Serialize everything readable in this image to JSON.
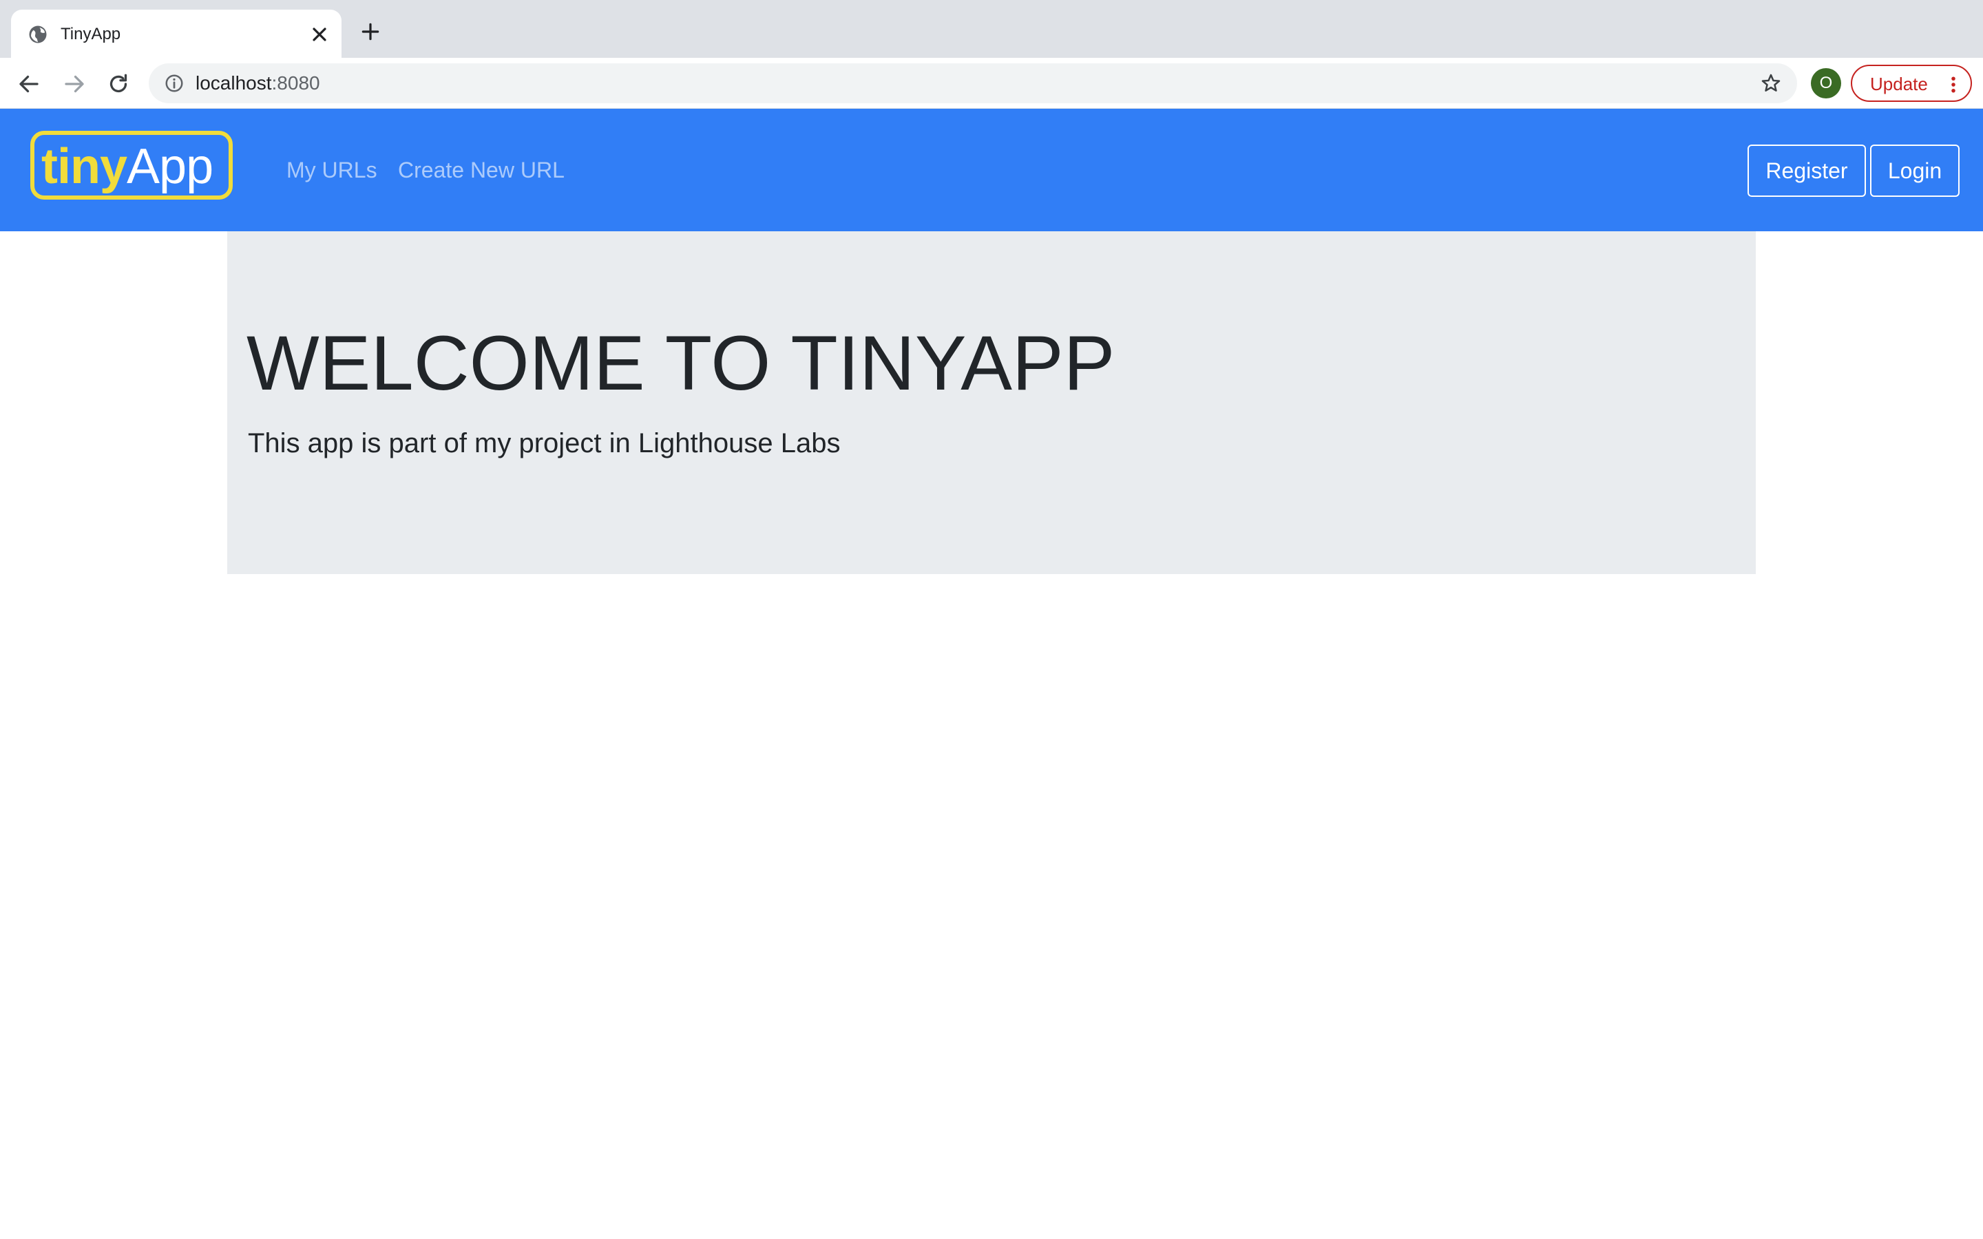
{
  "browser": {
    "tab_title": "TinyApp",
    "url_host": "localhost",
    "url_port": ":8080",
    "profile_initial": "O",
    "update_label": "Update"
  },
  "navbar": {
    "brand_tiny": "tiny",
    "brand_app": "App",
    "links": [
      "My URLs",
      "Create New URL"
    ],
    "register_label": "Register",
    "login_label": "Login"
  },
  "jumbotron": {
    "title": "WELCOME TO TINYAPP",
    "lead": "This app is part of my project in Lighthouse Labs"
  },
  "colors": {
    "navbar": "#317ef6",
    "brand_yellow": "#f1dc3b",
    "jumbotron_bg": "#e9ecef",
    "update_red": "#c5221f",
    "profile_green": "#3a6b24"
  },
  "icons": [
    "globe-icon",
    "close-icon",
    "plus-icon",
    "back-arrow-icon",
    "forward-arrow-icon",
    "reload-icon",
    "info-icon",
    "star-icon",
    "more-vert-icon"
  ]
}
